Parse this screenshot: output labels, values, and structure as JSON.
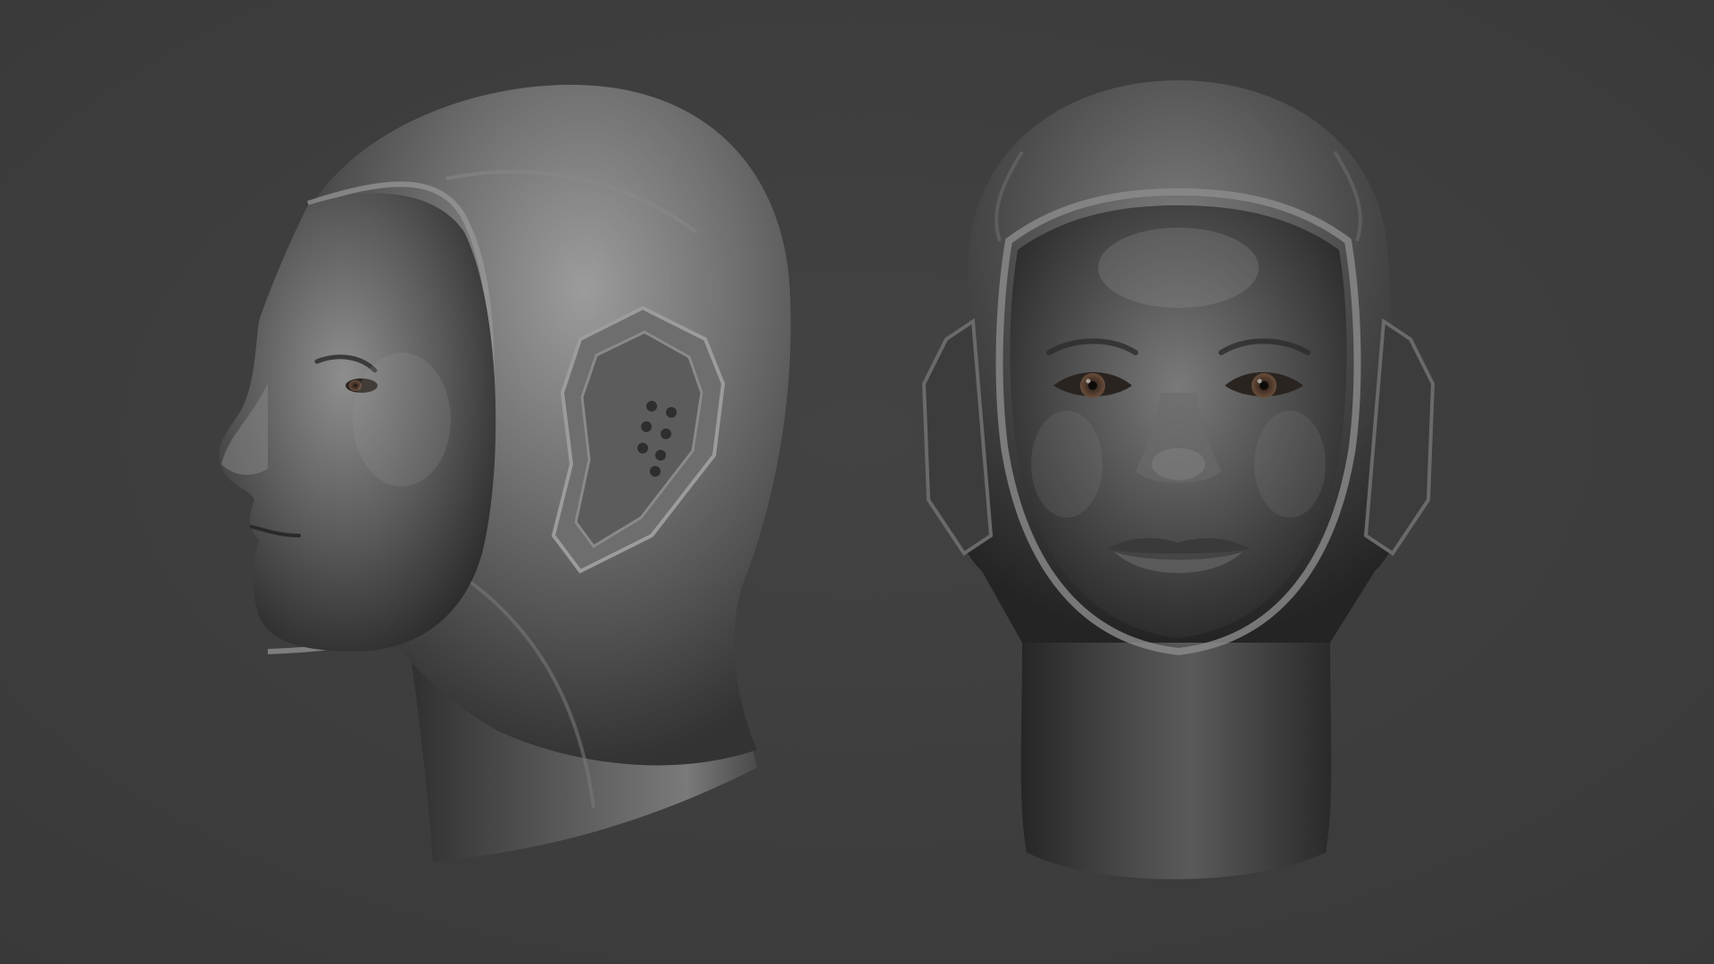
{
  "scene": {
    "views": [
      "side-profile",
      "front"
    ],
    "colors": {
      "background": "#3d3d3d",
      "clay_light": "#a8a8a8",
      "clay_mid": "#6e6e6e",
      "clay_dark": "#2e2e2e",
      "iris": "#6a4e3c"
    },
    "icons": [
      "ear-module-icon"
    ]
  }
}
